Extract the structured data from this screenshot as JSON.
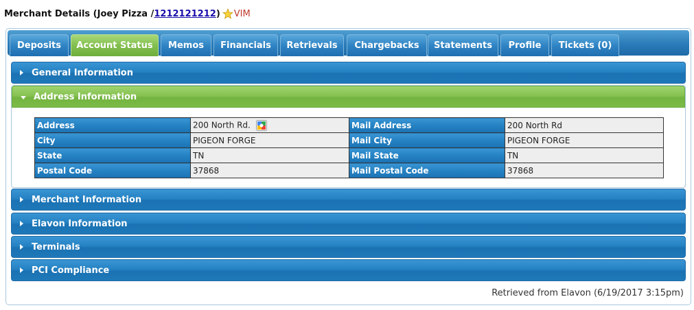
{
  "header": {
    "title_prefix": "Merchant Details (Joey Pizza /",
    "account_number": "1212121212",
    "title_suffix": ")",
    "vim_label": "VIM"
  },
  "tabs": [
    {
      "label": "Deposits",
      "active": false
    },
    {
      "label": "Account Status",
      "active": true
    },
    {
      "label": "Memos",
      "active": false
    },
    {
      "label": "Financials",
      "active": false
    },
    {
      "label": "Retrievals",
      "active": false
    },
    {
      "label": "Chargebacks",
      "active": false
    },
    {
      "label": "Statements",
      "active": false
    },
    {
      "label": "Profile",
      "active": false
    },
    {
      "label": "Tickets (0)",
      "active": false
    }
  ],
  "sections": {
    "general": "General Information",
    "address": "Address Information",
    "merchant": "Merchant Information",
    "elavon": "Elavon Information",
    "terminals": "Terminals",
    "pci": "PCI Compliance"
  },
  "address_table": {
    "rows": [
      {
        "label": "Address",
        "value": "200 North Rd.",
        "mail_label": "Mail Address",
        "mail_value": "200 North Rd"
      },
      {
        "label": "City",
        "value": "PIGEON FORGE",
        "mail_label": "Mail City",
        "mail_value": "PIGEON FORGE"
      },
      {
        "label": "State",
        "value": "TN",
        "mail_label": "Mail State",
        "mail_value": "TN"
      },
      {
        "label": "Postal Code",
        "value": "37868",
        "mail_label": "Mail Postal Code",
        "mail_value": "37868"
      }
    ]
  },
  "footer": {
    "retrieved": "Retrieved from Elavon (6/19/2017 3:15pm)"
  },
  "colors": {
    "tab_blue": "#2a7bb9",
    "active_green": "#82bf4e",
    "link_blue": "#1a0dab",
    "vim_red": "#c0392b"
  },
  "icons": {
    "star": "star-icon",
    "map": "google-maps-icon"
  }
}
